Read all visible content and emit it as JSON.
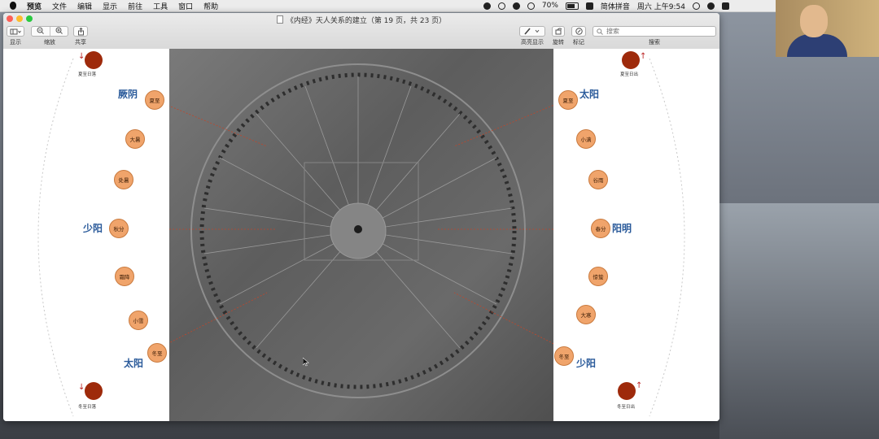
{
  "menubar": {
    "app_name": "预览",
    "menus": [
      "文件",
      "编辑",
      "显示",
      "前往",
      "工具",
      "窗口",
      "帮助"
    ],
    "battery": "70%",
    "input_method": "简体拼音",
    "clock": "周六 上午9:54"
  },
  "window": {
    "title": "《内经》天人关系的建立（第 19 页，共 23 页）",
    "toolbar": {
      "view_label": "显示",
      "zoom_label": "缩放",
      "share_label": "共享",
      "highlight_label": "高亮显示",
      "rotate_label": "旋转",
      "markup_label": "标记",
      "search_label": "搜索",
      "search_placeholder": "搜索"
    }
  },
  "slide": {
    "left_labels": [
      "夏至",
      "大暑",
      "处暑",
      "秋分",
      "霜降",
      "小雪",
      "冬至"
    ],
    "right_labels": [
      "夏至",
      "小满",
      "谷雨",
      "春分",
      "惊蛰",
      "大寒",
      "冬至"
    ],
    "big_labels": {
      "jueyin": "厥阴",
      "shaoyang": "少阳",
      "taiyang_left": "太阳",
      "taiyang_right": "太阳",
      "yangming": "阳明",
      "shaoyin": "少阳"
    },
    "sun_captions": {
      "top_left": "夏至日落",
      "top_right": "夏至日出",
      "bottom_left": "冬至日落",
      "bottom_right": "冬至日出"
    },
    "arrows": {
      "down": "↓",
      "up": "↑"
    }
  },
  "colors": {
    "accent_blue": "#2a5a9a",
    "node_fill": "#f0a46b",
    "sun_red": "#9e2a0b"
  }
}
